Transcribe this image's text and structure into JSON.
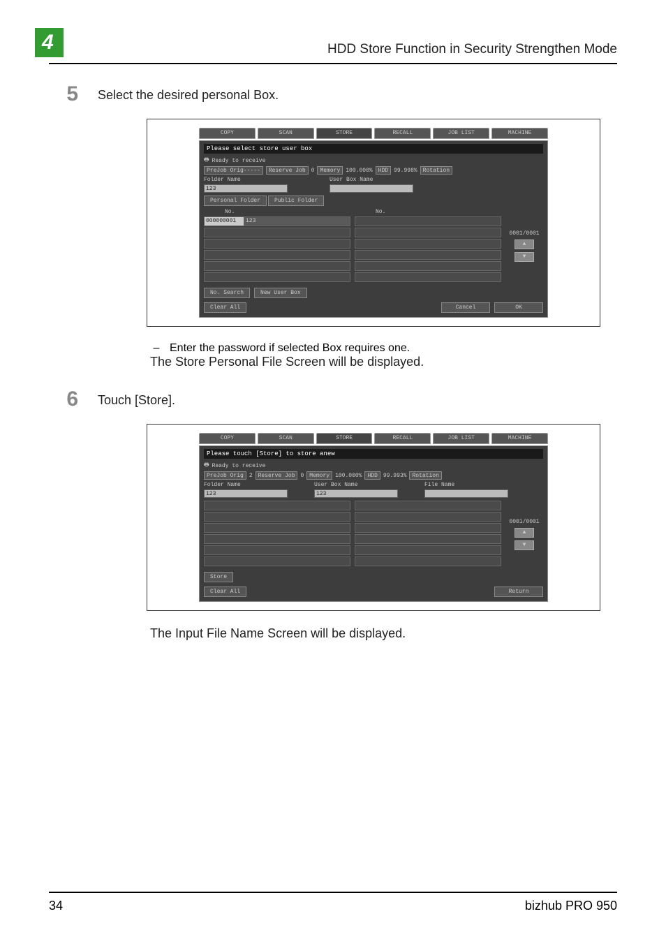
{
  "header": {
    "section_number": "4",
    "title": "HDD Store Function in Security Strengthen Mode"
  },
  "step5": {
    "number": "5",
    "text": "Select the desired personal Box.",
    "note_bullet": "Enter the password if selected Box requires one.",
    "note_follow": "The Store Personal File Screen will be displayed."
  },
  "step6": {
    "number": "6",
    "text": "Touch [Store].",
    "note_follow": "The Input File Name Screen will be displayed."
  },
  "screen1": {
    "tabs": [
      "COPY",
      "SCAN",
      "STORE",
      "RECALL",
      "JOB LIST",
      "MACHINE"
    ],
    "title": "Please select store user box",
    "ready": "Ready to receive",
    "prejob": "PreJob Orig-----",
    "reserve": "Reserve Job",
    "reserve_n": "0",
    "memory": "Memory",
    "memory_pct": "100.000%",
    "hdd": "HDD",
    "hdd_pct": "99.998%",
    "rotation": "Rotation",
    "folder_name_label": "Folder Name",
    "folder_name_value": "123",
    "user_box_label": "User Box Name",
    "subtabs": [
      "Personal Folder",
      "Public Folder"
    ],
    "no_label": "No.",
    "row1_num": "000000001",
    "row1_text": "123",
    "counter": "0001/0001",
    "btn_no_search": "No. Search",
    "btn_new_user_box": "New User Box",
    "btn_clear_all": "Clear All",
    "btn_cancel": "Cancel",
    "btn_ok": "OK"
  },
  "screen2": {
    "tabs": [
      "COPY",
      "SCAN",
      "STORE",
      "RECALL",
      "JOB LIST",
      "MACHINE"
    ],
    "title": "Please touch [Store] to store anew",
    "ready": "Ready to receive",
    "prejob": "PreJob Orig",
    "prejob_n": "2",
    "reserve": "Reserve Job",
    "reserve_n": "0",
    "memory": "Memory",
    "memory_pct": "100.000%",
    "hdd": "HDD",
    "hdd_pct": "99.993%",
    "rotation": "Rotation",
    "folder_name_label": "Folder Name",
    "folder_name_value": "123",
    "user_box_label": "User Box Name",
    "user_box_value": "123",
    "file_name_label": "File Name",
    "counter": "0001/0001",
    "btn_store": "Store",
    "btn_clear_all": "Clear All",
    "btn_return": "Return"
  },
  "footer": {
    "page_number": "34",
    "product": "bizhub PRO 950"
  }
}
